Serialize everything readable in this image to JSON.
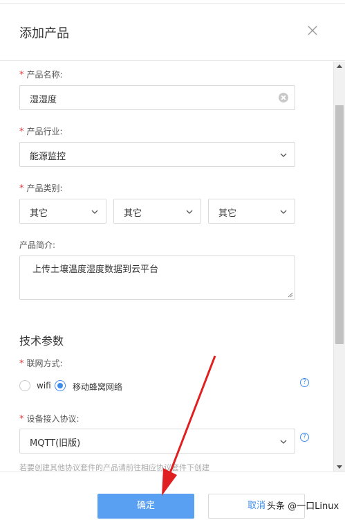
{
  "dialog": {
    "title": "添加产品"
  },
  "form": {
    "product_name": {
      "label": "产品名称:",
      "value": "湿湿度"
    },
    "industry": {
      "label": "产品行业:",
      "value": "能源监控"
    },
    "category": {
      "label": "产品类别:",
      "values": [
        "其它",
        "其它",
        "其它"
      ]
    },
    "description": {
      "label": "产品简介:",
      "value": "上传土壤温度湿度数据到云平台"
    }
  },
  "tech": {
    "section_title": "技术参数",
    "network": {
      "label": "联网方式:",
      "options": [
        "wifi",
        "移动蜂窝网络"
      ],
      "selected": "移动蜂窝网络"
    },
    "protocol": {
      "label": "设备接入协议:",
      "value": "MQTT(旧版)",
      "hint": "若要创建其他协议套件的产品请前往相应协议套件下创建"
    },
    "help_glyph": "?"
  },
  "footer": {
    "ok_label": "确定",
    "cancel_label": "取消"
  },
  "watermark": "头条 @一口Linux",
  "colors": {
    "primary": "#5aa0f2",
    "link": "#3d8cf0",
    "required": "#e4393c",
    "annotation_arrow": "#e02020"
  }
}
